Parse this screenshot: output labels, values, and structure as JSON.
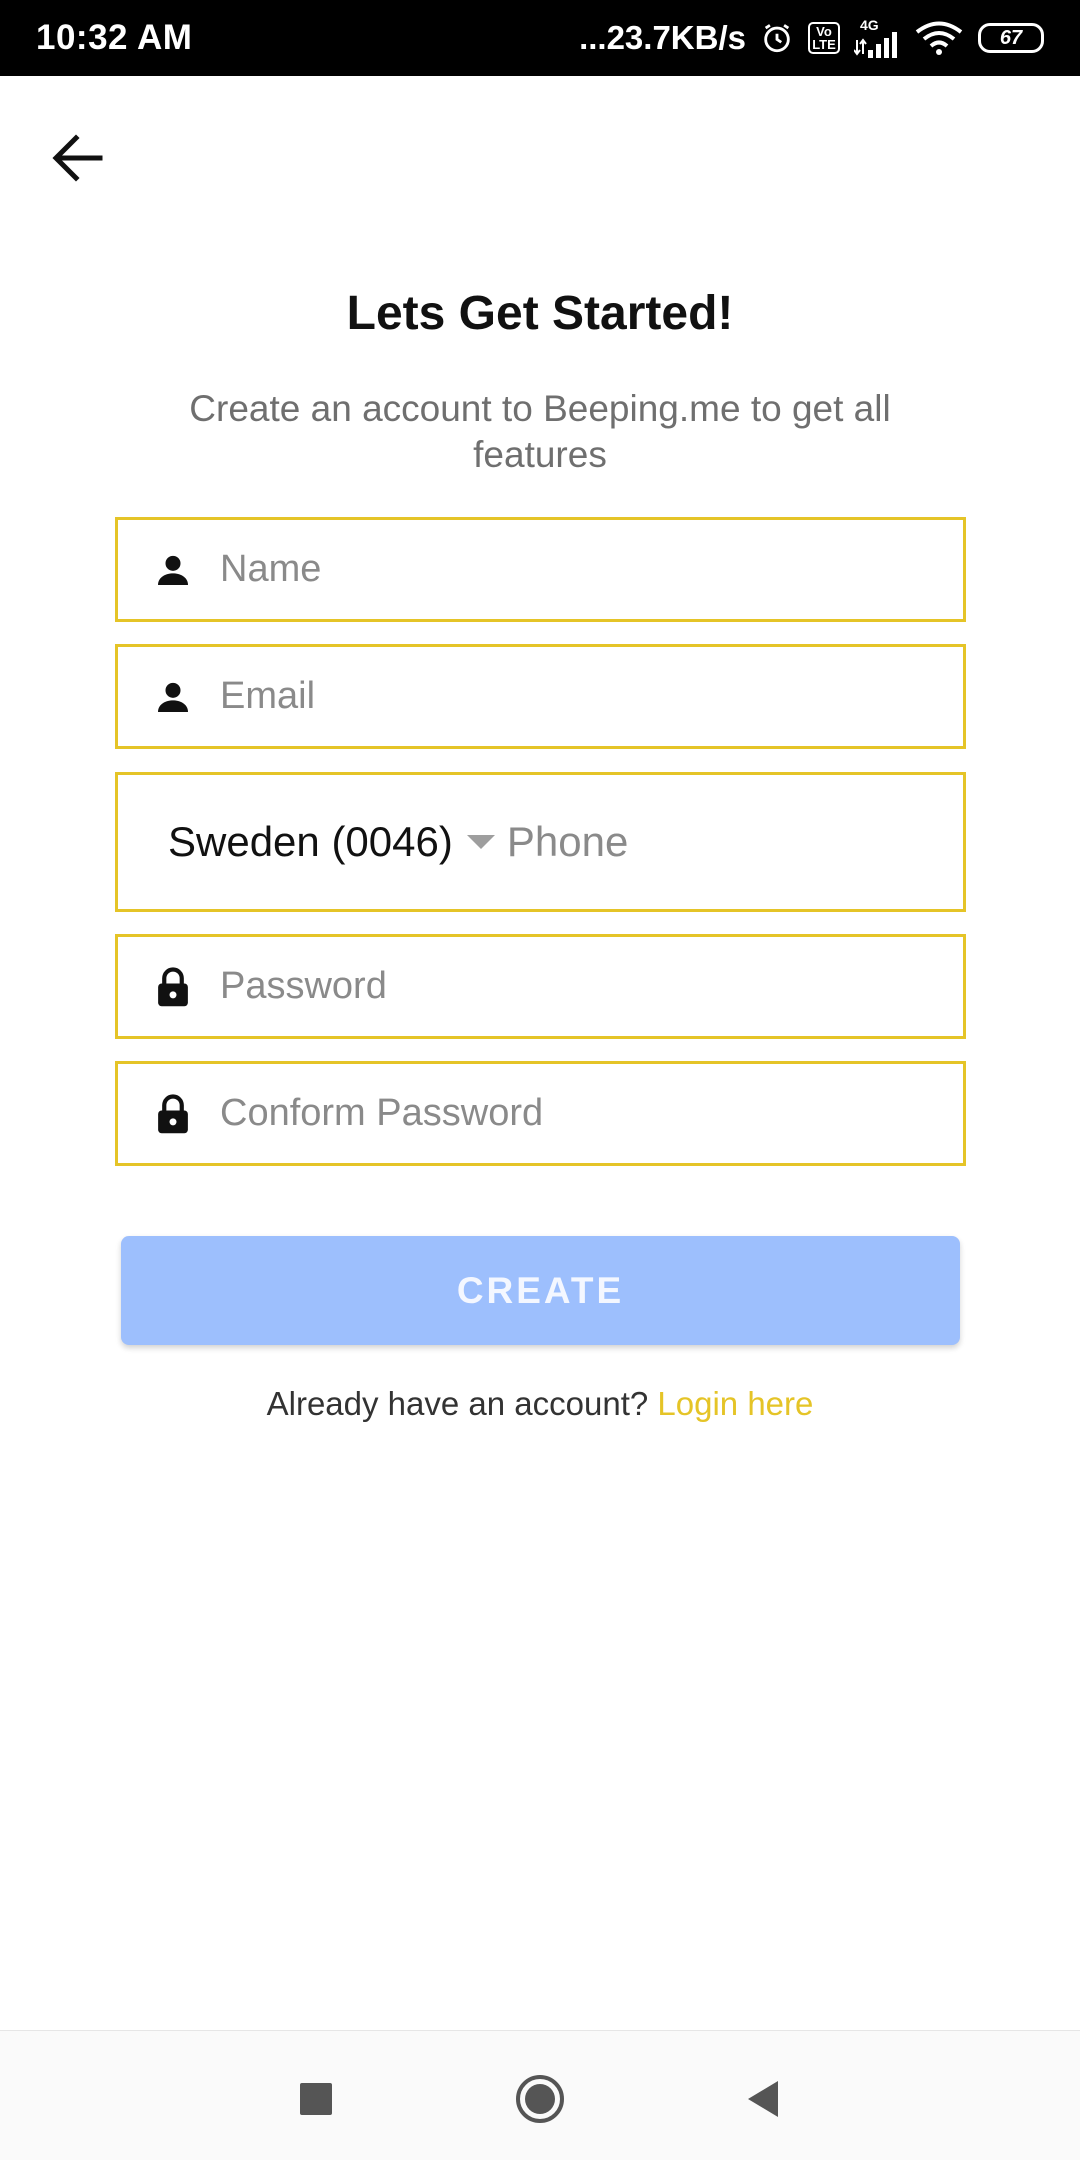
{
  "status_bar": {
    "time": "10:32 AM",
    "net_speed": "...23.7KB/s",
    "volte_label_top": "Vo",
    "volte_label_bottom": "LTE",
    "network_type": "4G",
    "battery": "67"
  },
  "header": {
    "title": "Lets Get Started!",
    "subtitle": "Create an account to Beeping.me to get all features"
  },
  "form": {
    "name_placeholder": "Name",
    "email_placeholder": "Email",
    "country_code": "Sweden (0046)",
    "phone_placeholder": "Phone",
    "password_placeholder": "Password",
    "confirm_placeholder": "Conform Password",
    "create_label": "CREATE"
  },
  "footer": {
    "already_text": "Already have an account?",
    "login_link": "Login here"
  },
  "colors": {
    "field_border": "#e5c427",
    "button_bg": "#9dbffd",
    "link": "#e5c427"
  },
  "icons": {
    "back": "arrow-left-icon",
    "person": "person-icon",
    "lock": "lock-icon",
    "dropdown": "caret-down-icon"
  }
}
